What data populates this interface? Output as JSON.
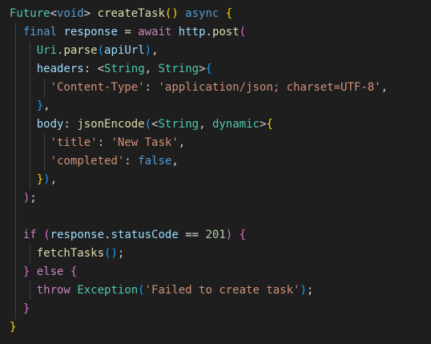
{
  "code": {
    "language": "dart",
    "lines": [
      "Future<void> createTask() async {",
      "  final response = await http.post(",
      "    Uri.parse(apiUrl),",
      "    headers: <String, String>{",
      "      'Content-Type': 'application/json; charset=UTF-8',",
      "    },",
      "    body: jsonEncode(<String, dynamic>{",
      "      'title': 'New Task',",
      "      'completed': false,",
      "    }),",
      "  );",
      "",
      "  if (response.statusCode == 201) {",
      "    fetchTasks();",
      "  } else {",
      "    throw Exception('Failed to create task');",
      "  }",
      "}"
    ]
  },
  "tokens": {
    "l1": {
      "future": "Future",
      "lt": "<",
      "void": "void",
      "gt": ">",
      "name": "createTask",
      "parens": "()",
      "async": "async",
      "brace": "{"
    },
    "l2": {
      "final": "final",
      "response": "response",
      "eq": "=",
      "await": "await",
      "http": "http",
      "dot": ".",
      "post": "post",
      "paren": "("
    },
    "l3": {
      "uri": "Uri",
      "dot": ".",
      "parse": "parse",
      "open": "(",
      "apiUrl": "apiUrl",
      "close": ")",
      "comma": ","
    },
    "l4": {
      "headers": "headers",
      "colon": ":",
      "lt": "<",
      "string1": "String",
      "comma": ",",
      "string2": "String",
      "gt": ">",
      "brace": "{"
    },
    "l5": {
      "key": "'Content-Type'",
      "colon": ":",
      "value": "'application/json; charset=UTF-8'",
      "comma": ","
    },
    "l6": {
      "brace": "}",
      "comma": ","
    },
    "l7": {
      "body": "body",
      "colon": ":",
      "jsonEncode": "jsonEncode",
      "paren": "(",
      "lt": "<",
      "string": "String",
      "comma": ",",
      "dynamic": "dynamic",
      "gt": ">",
      "brace": "{"
    },
    "l8": {
      "key": "'title'",
      "colon": ":",
      "value": "'New Task'",
      "comma": ","
    },
    "l9": {
      "key": "'completed'",
      "colon": ":",
      "value": "false",
      "comma": ","
    },
    "l10": {
      "brace": "}",
      "paren": ")",
      "comma": ","
    },
    "l11": {
      "paren": ")",
      "semi": ";"
    },
    "l13": {
      "if": "if",
      "open": "(",
      "response": "response",
      "dot": ".",
      "statusCode": "statusCode",
      "op": "==",
      "num": "201",
      "close": ")",
      "brace": "{"
    },
    "l14": {
      "fetchTasks": "fetchTasks",
      "parens": "()",
      "semi": ";"
    },
    "l15": {
      "close": "}",
      "else": "else",
      "open": "{"
    },
    "l16": {
      "throw": "throw",
      "exception": "Exception",
      "open": "(",
      "msg": "'Failed to create task'",
      "close": ")",
      "semi": ";"
    },
    "l17": {
      "brace": "}"
    },
    "l18": {
      "brace": "}"
    }
  }
}
